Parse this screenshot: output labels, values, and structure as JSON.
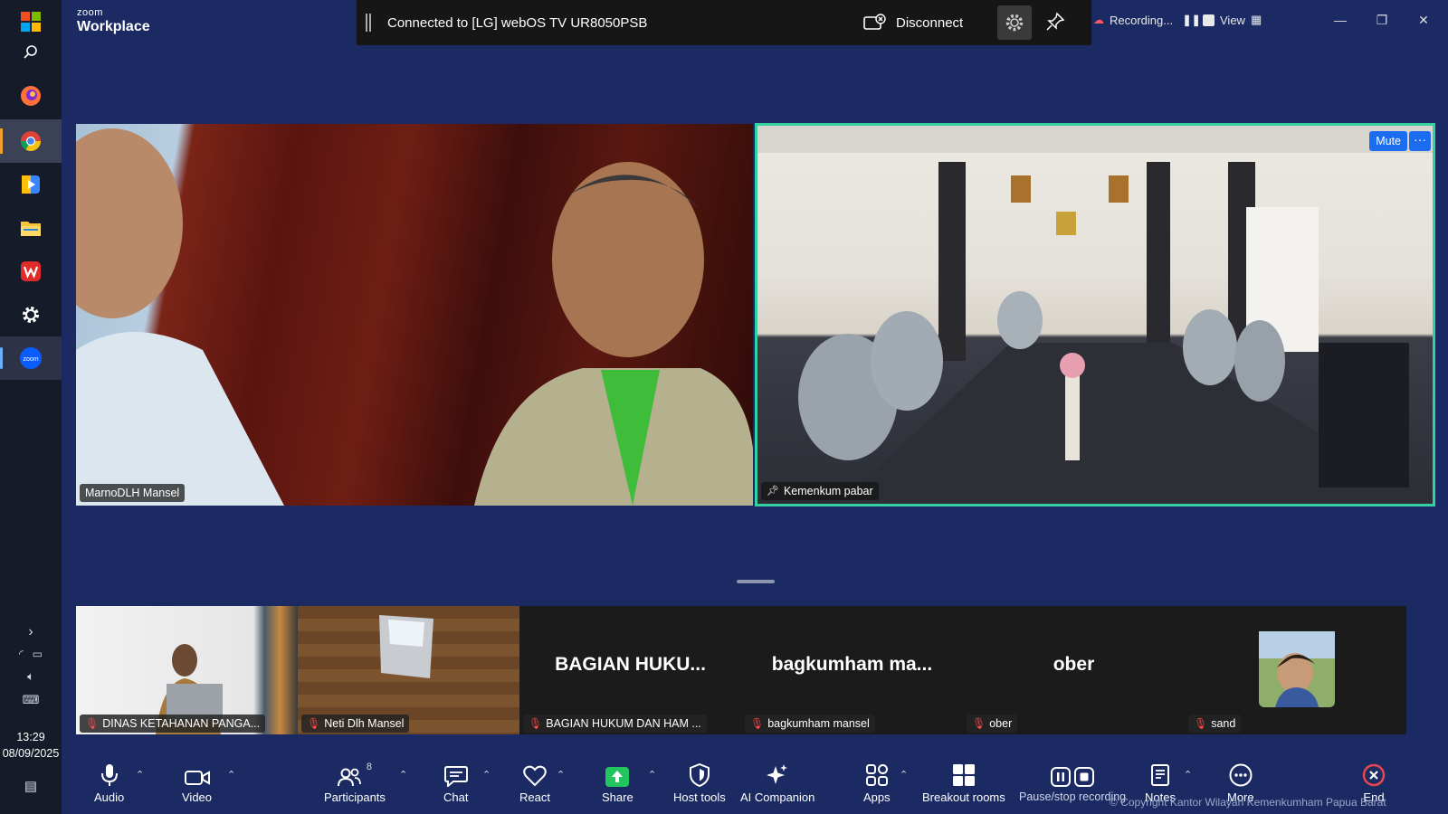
{
  "taskbar": {
    "time": "13:29",
    "date": "08/09/2025",
    "apps": [
      "windows-start",
      "search",
      "firefox",
      "chrome",
      "media-player",
      "file-explorer",
      "wps-office",
      "settings",
      "zoom"
    ]
  },
  "app": {
    "brand_small": "zoom",
    "brand_name": "Workplace"
  },
  "cast": {
    "status": "Connected to [LG] webOS TV UR8050PSB",
    "disconnect_label": "Disconnect"
  },
  "recording": {
    "label": "Recording...",
    "view_label": "View"
  },
  "video": {
    "main_tiles": [
      {
        "name": "MarnoDLH Mansel"
      },
      {
        "name": "Kemenkum pabar",
        "mute_label": "Mute",
        "more_label": "···"
      }
    ],
    "strip_tiles": [
      {
        "name": "DINAS KETAHANAN PANGA...",
        "display": ""
      },
      {
        "name": "Neti Dlh Mansel",
        "display": ""
      },
      {
        "name": "BAGIAN HUKUM DAN HAM ...",
        "display": "BAGIAN  HUKU..."
      },
      {
        "name": "bagkumham mansel",
        "display": "bagkumham  ma..."
      },
      {
        "name": "ober",
        "display": "ober"
      },
      {
        "name": "sand",
        "display": ""
      }
    ]
  },
  "toolbar": {
    "audio": "Audio",
    "video": "Video",
    "participants": "Participants",
    "participants_count": "8",
    "chat": "Chat",
    "react": "React",
    "share": "Share",
    "host_tools": "Host tools",
    "ai_companion": "AI Companion",
    "apps": "Apps",
    "breakout_rooms": "Breakout rooms",
    "pause_stop_recording": "Pause/stop recording",
    "notes": "Notes",
    "more": "More",
    "end": "End"
  },
  "watermark": "© Copyright Kantor Wilayah Kemenkumham Papua Barat",
  "colors": {
    "meeting_bg": "#1b2a63",
    "active_speaker_border": "#35d0a0",
    "mute_button": "#1a6cf0",
    "share_green": "#22c55e",
    "end_red": "#e5484d"
  }
}
